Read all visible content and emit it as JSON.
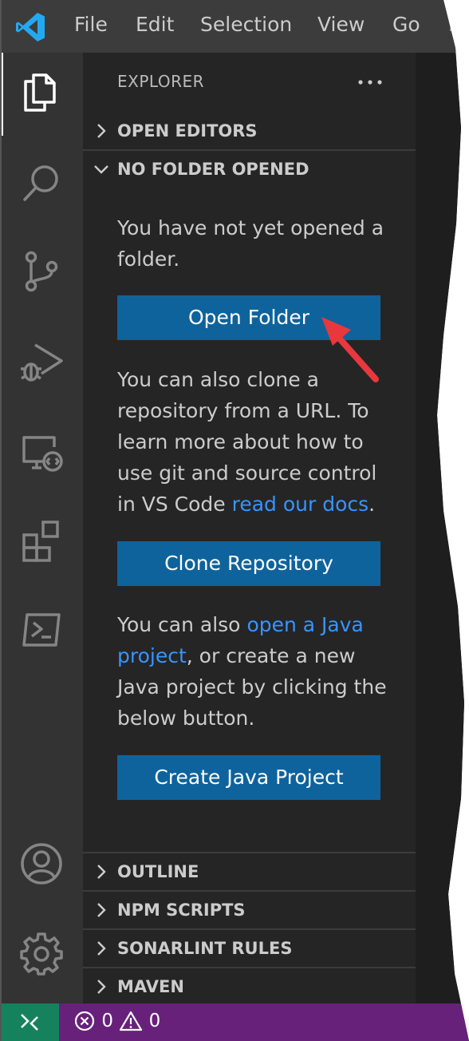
{
  "titlebar": {
    "menu": [
      "File",
      "Edit",
      "Selection",
      "View",
      "Go",
      "R"
    ]
  },
  "activity_bar": {
    "icons": [
      "explorer-icon",
      "search-icon",
      "source-control-icon",
      "run-debug-icon",
      "remote-explorer-icon",
      "extensions-icon",
      "terminal-icon",
      "account-icon",
      "settings-gear-icon"
    ],
    "active": "explorer-icon"
  },
  "sidebar": {
    "title": "EXPLORER",
    "more_actions": "...",
    "open_editors": "OPEN EDITORS",
    "no_folder": "NO FOLDER OPENED",
    "intro_text": "You have not yet opened a folder.",
    "open_folder_button": "Open Folder",
    "clone_text_before": "You can also clone a repository from a URL. To learn more about how to use git and source control in VS Code ",
    "clone_text_link": "read our docs",
    "clone_text_after": ".",
    "clone_button": "Clone Repository",
    "java_text_before": "You can also ",
    "java_text_link": "open a Java project",
    "java_text_after": ", or create a new Java project by clicking the below button.",
    "java_button": "Create Java Project",
    "sections": [
      "OUTLINE",
      "NPM SCRIPTS",
      "SONARLINT RULES",
      "MAVEN"
    ]
  },
  "statusbar": {
    "errors": "0",
    "warnings": "0"
  },
  "colors": {
    "button_bg": "#0e639c",
    "link": "#3794ff",
    "statusbar": "#68217a",
    "remote": "#16825d",
    "annotation_arrow": "#e8383d"
  }
}
